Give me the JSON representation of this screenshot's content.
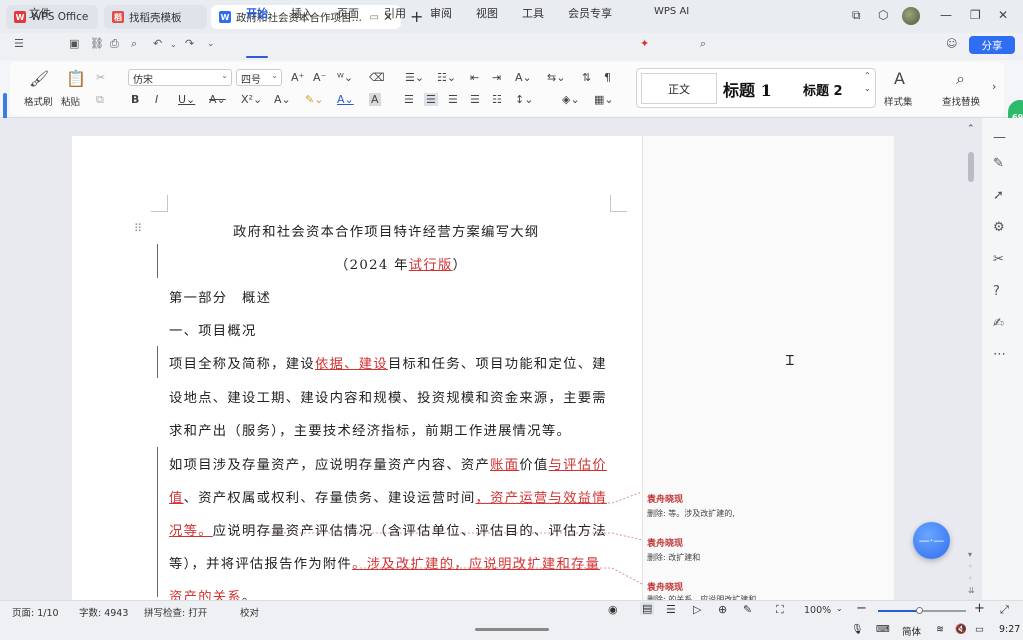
{
  "tabs": [
    {
      "label": "WPS Office"
    },
    {
      "label": "找稻壳模板"
    },
    {
      "label": "政府和社会资本合作项目特许"
    }
  ],
  "menu": {
    "file": "文件",
    "items": [
      "开始",
      "插入",
      "页面",
      "引用",
      "审阅",
      "视图",
      "工具",
      "会员专享"
    ],
    "wps_ai": "WPS AI",
    "share": "分享"
  },
  "ribbon": {
    "format_painter": "格式刷",
    "paste": "粘贴",
    "font_name": "仿宋",
    "font_size": "四号",
    "styles": {
      "normal": "正文",
      "h1": "标题 1",
      "h2": "标题 2"
    },
    "styles_set": "样式集",
    "find_replace": "查找替换"
  },
  "document": {
    "title": "政府和社会资本合作项目特许经营方案编写大纲",
    "subtitle_pre": "（2024 年",
    "subtitle_rev": "试行版",
    "subtitle_post": "）",
    "part1": "第一部分　概述",
    "section1": "一、项目概况",
    "p1": [
      {
        "pre": "项目全称及简称，建设",
        "rev": "依据、建设",
        "post": "目标和任务、项目功能和定位、建"
      },
      {
        "pre": "设地点、建设工期、建设内容和规模、投资规模和资金来源，主要需",
        "rev": "",
        "post": ""
      },
      {
        "pre": "求和产出（服务），主要技术经济指标，前期工作进展情况等。",
        "rev": "",
        "post": ""
      }
    ],
    "p2": [
      {
        "pre": "如项目涉及存量资产，应说明存量资产内容、资产",
        "rev": "账面",
        "mid": "价值",
        "rev2": "与评估价",
        "post": ""
      },
      {
        "pre": "",
        "rev": "值",
        "mid": "、资产权属或权利、存量债务、建设运营时间",
        "rev2": "，资产运营与效益情",
        "post": ""
      },
      {
        "pre": "",
        "rev": "况等。",
        "mid": "应说明存量资产评估情况（含评估单位、评估目的、评估方法",
        "rev2": "",
        "post": ""
      },
      {
        "pre": "",
        "rev": "",
        "mid": "等），并将评估报告作为附件",
        "rev2": "。涉及改扩建的，应说明改扩建和存量",
        "post": ""
      },
      {
        "pre": "",
        "rev": "资产的关系",
        "mid": "。",
        "rev2": "",
        "post": ""
      }
    ]
  },
  "comments": [
    {
      "author": "袁舟晓现",
      "text": "删除: 等。涉及改扩建的,"
    },
    {
      "author": "袁舟晓现",
      "text": "删除: 改扩建和"
    },
    {
      "author": "袁舟晓现",
      "text": "删除: 的关系，应说明改扩建和"
    }
  ],
  "status": {
    "page": "页面: 1/10",
    "words": "字数: 4943",
    "spellcheck": "拼写检查: 打开",
    "proofread": "校对",
    "zoom": "100%",
    "zoom_fraction": 0.48
  },
  "os": {
    "lang": "简体",
    "time": "9:27"
  },
  "badge": "69"
}
